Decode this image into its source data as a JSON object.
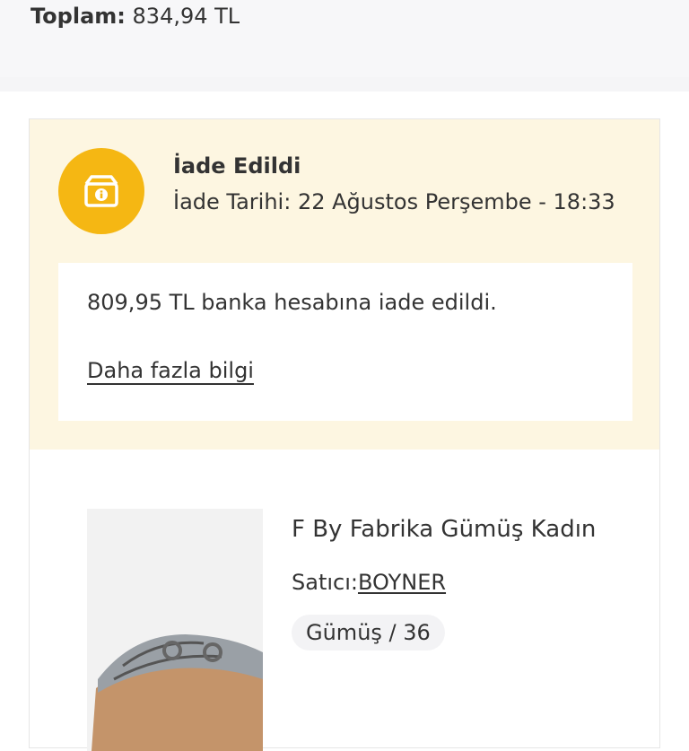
{
  "order_total": {
    "label": "Toplam:",
    "value": "834,94 TL"
  },
  "return_status": {
    "icon": "return-box-icon",
    "icon_color": "#f5b713",
    "title": "İade Edildi",
    "date_label": "İade Tarihi:",
    "date_value": "22 Ağustos Perşembe - 18:33",
    "message": "809,95 TL banka hesabına iade edildi.",
    "more_info_link": "Daha fazla bilgi"
  },
  "product": {
    "title": "F By Fabrika Gümüş Kadın",
    "seller_label": "Satıcı:",
    "seller_name": "BOYNER",
    "variant": "Gümüş / 36",
    "image_icon": "sandal-product-image"
  }
}
